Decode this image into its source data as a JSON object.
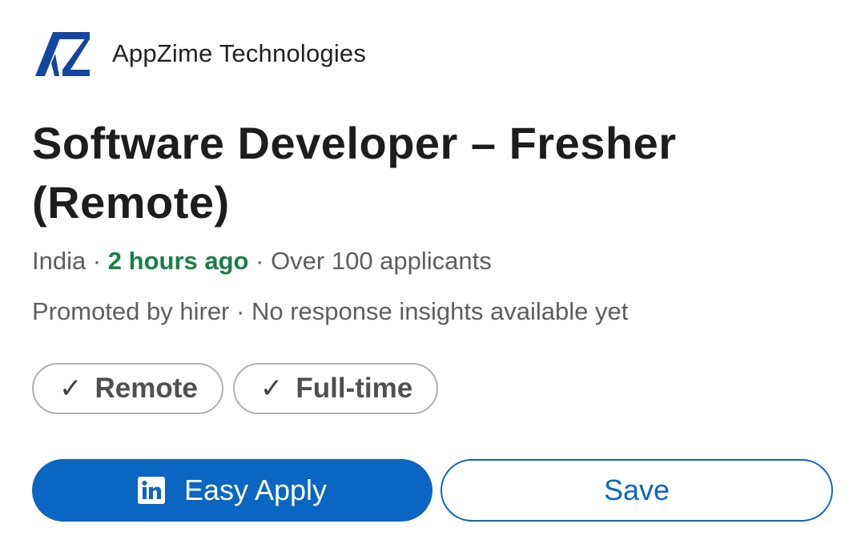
{
  "company": {
    "name": "AppZime Technologies",
    "logo_icon": "appzime-logo",
    "logo_color": "#1446a0"
  },
  "job": {
    "title": "Software Developer – Fresher (Remote)"
  },
  "meta": {
    "location": "India",
    "separator": " · ",
    "posted": "2 hours ago",
    "applicants": "Over 100 applicants",
    "promoted": "Promoted by hirer",
    "insights": "No response insights available yet",
    "posted_color": "#1a7f46"
  },
  "tags": [
    {
      "icon": "checkmark-icon",
      "label": "Remote"
    },
    {
      "icon": "checkmark-icon",
      "label": "Full-time"
    }
  ],
  "actions": {
    "apply_label": "Easy Apply",
    "apply_icon": "linkedin-icon",
    "save_label": "Save",
    "accent_color": "#0a66c2"
  }
}
